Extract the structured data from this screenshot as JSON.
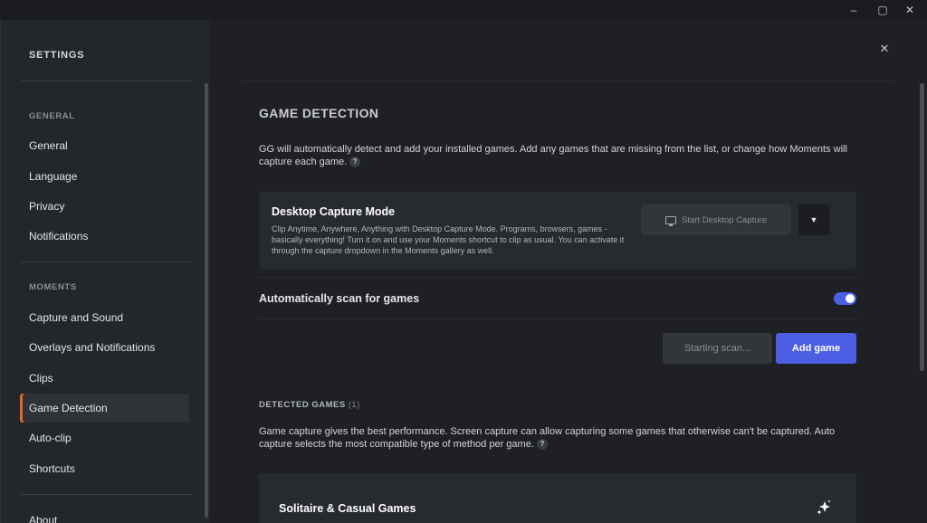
{
  "window": {
    "minimize": "–",
    "maximize": "▢",
    "close": "✕"
  },
  "sidebar": {
    "title": "SETTINGS",
    "sections": [
      {
        "label": "GENERAL",
        "items": [
          "General",
          "Language",
          "Privacy",
          "Notifications"
        ]
      },
      {
        "label": "MOMENTS",
        "items": [
          "Capture and Sound",
          "Overlays and Notifications",
          "Clips",
          "Game Detection",
          "Auto-clip",
          "Shortcuts"
        ]
      }
    ],
    "active_item": "Game Detection",
    "bottom_item": "About"
  },
  "main": {
    "close_label": "✕",
    "title": "GAME DETECTION",
    "description": "GG will automatically detect and add your installed games. Add any games that are missing from the list, or change how Moments will capture each game.",
    "help": "?",
    "desktop_capture": {
      "title": "Desktop Capture Mode",
      "description": "Clip Anytime, Anywhere, Anything with Desktop Capture Mode. Programs, browsers, games - basically everything! Turn it on and use your Moments shortcut to clip as usual. You can activate it through the capture dropdown in the Moments gallery as well.",
      "button_label": "Start Desktop Capture",
      "dropdown_glyph": "▼"
    },
    "auto_scan": {
      "label": "Automatically scan for games",
      "enabled": true
    },
    "scan_button": "Starting scan...",
    "add_game_button": "Add game",
    "detected": {
      "label": "DETECTED GAMES",
      "count": "(1)",
      "description": "Game capture gives the best performance. Screen capture can allow capturing some games that otherwise can't be captured. Auto capture selects the most compatible type of method per game.",
      "help": "?",
      "games": [
        {
          "name": "Solitaire & Casual Games",
          "icon": "sparkle-icon"
        }
      ]
    }
  },
  "colors": {
    "accent": "#4b5ee4",
    "active_marker": "#e06a2c",
    "background": "#1e2023",
    "sidebar": "#23262a"
  }
}
